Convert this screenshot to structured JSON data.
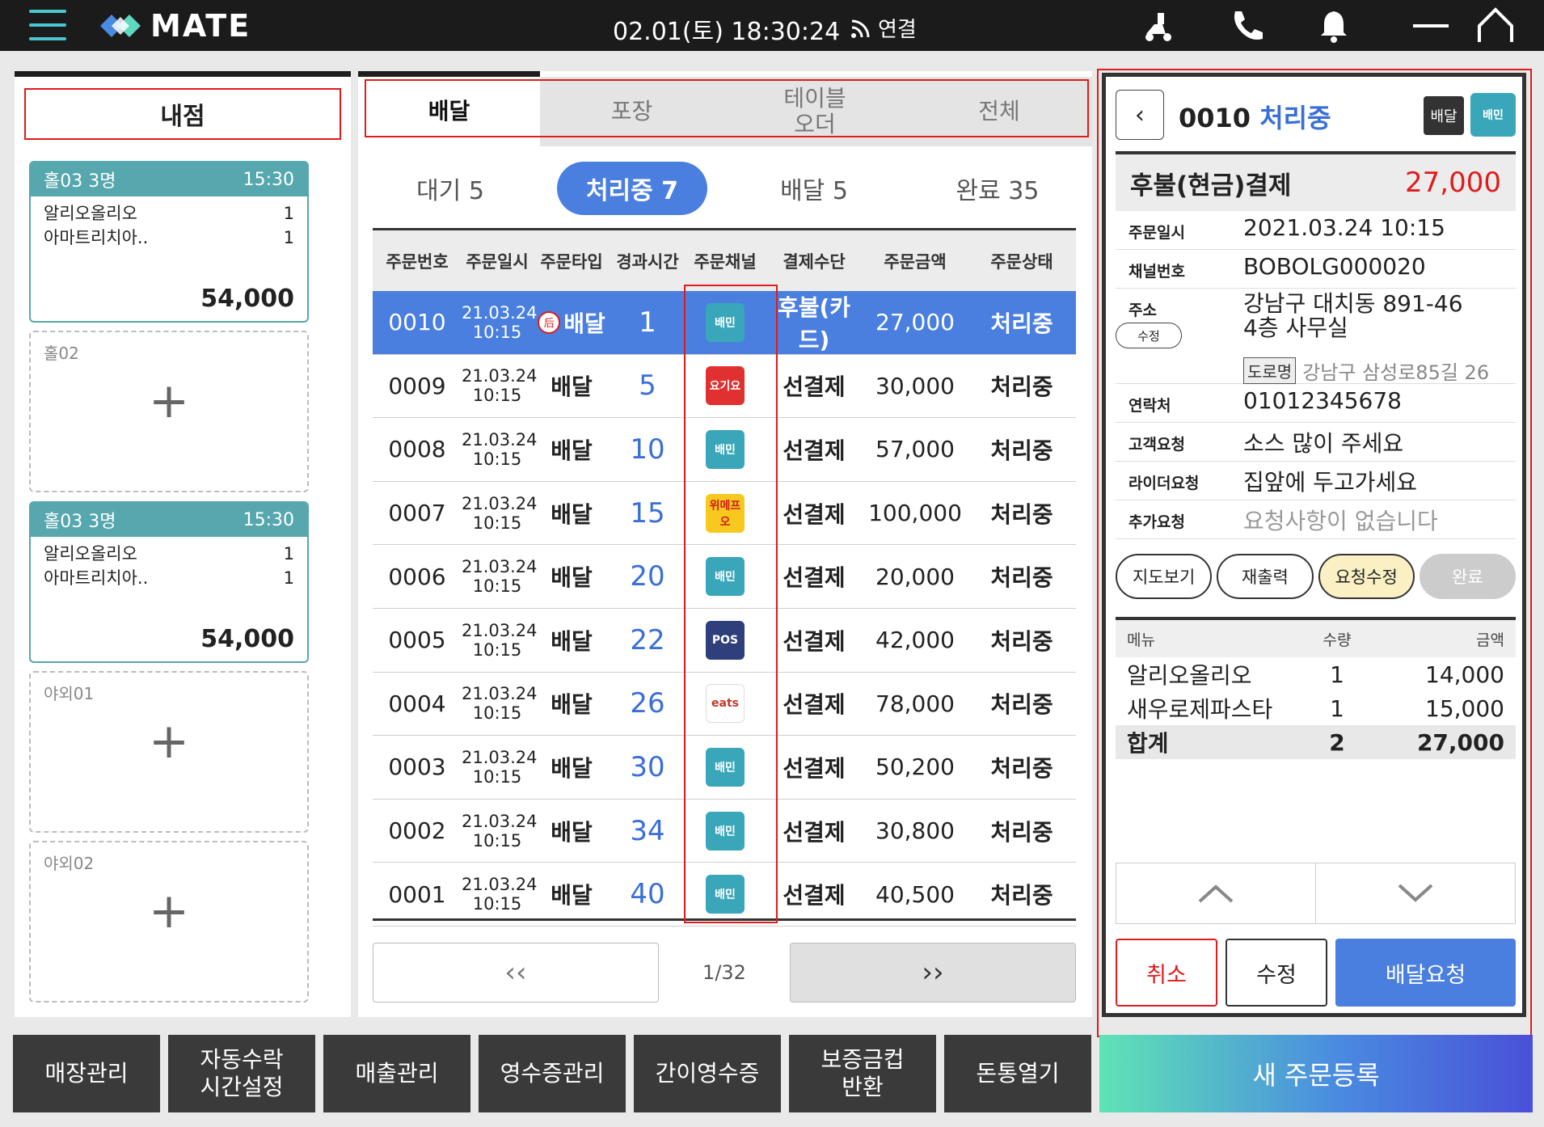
{
  "header": {
    "brand": "MATE",
    "datetime": "02.01(토) 18:30:24",
    "connection": "연결",
    "icons": [
      "menu-icon",
      "rider-icon",
      "phone-icon",
      "bell-icon",
      "minimize-icon",
      "home-icon"
    ]
  },
  "store": {
    "tab_label": "내점",
    "tables": [
      {
        "name": "홀03 3명",
        "time": "15:30",
        "items": [
          {
            "name": "알리오올리오",
            "qty": "1"
          },
          {
            "name": "아마트리치아..",
            "qty": "1"
          }
        ],
        "total": "54,000",
        "filled": true
      },
      {
        "name": "홀02",
        "filled": false,
        "add": "+"
      },
      {
        "name": "홀03 3명",
        "time": "15:30",
        "items": [
          {
            "name": "알리오올리오",
            "qty": "1"
          },
          {
            "name": "아마트리치아..",
            "qty": "1"
          }
        ],
        "total": "54,000",
        "filled": true
      },
      {
        "name": "야외01",
        "filled": false,
        "add": "+"
      },
      {
        "name": "야외02",
        "filled": false,
        "add": "+"
      }
    ]
  },
  "orders": {
    "tabs": [
      "배달",
      "포장",
      "테이블\n오더",
      "전체"
    ],
    "active_tab": 0,
    "statuses": [
      "대기 5",
      "처리중 7",
      "배달 5",
      "완료 35"
    ],
    "active_status": 1,
    "columns": [
      "주문번호",
      "주문일시",
      "주문타입",
      "경과시간",
      "주문채널",
      "결제수단",
      "주문금액",
      "주문상태"
    ],
    "rows": [
      {
        "no": "0010",
        "date": "21.03.24",
        "time": "10:15",
        "type": "배달",
        "type_badge": "后",
        "elapsed": "1",
        "channel": "baemin",
        "channel_label": "배민",
        "payment": "후불(카드)",
        "amount": "27,000",
        "status": "처리중",
        "selected": true
      },
      {
        "no": "0009",
        "date": "21.03.24",
        "time": "10:15",
        "type": "배달",
        "elapsed": "5",
        "channel": "yogiyo",
        "channel_label": "요기요",
        "payment": "선결제",
        "amount": "30,000",
        "status": "처리중"
      },
      {
        "no": "0008",
        "date": "21.03.24",
        "time": "10:15",
        "type": "배달",
        "elapsed": "10",
        "channel": "baemin",
        "channel_label": "배민",
        "payment": "선결제",
        "amount": "57,000",
        "status": "처리중"
      },
      {
        "no": "0007",
        "date": "21.03.24",
        "time": "10:15",
        "type": "배달",
        "elapsed": "15",
        "channel": "wemakeprice",
        "channel_label": "위메프오",
        "payment": "선결제",
        "amount": "100,000",
        "status": "처리중"
      },
      {
        "no": "0006",
        "date": "21.03.24",
        "time": "10:15",
        "type": "배달",
        "elapsed": "20",
        "channel": "baemin",
        "channel_label": "배민",
        "payment": "선결제",
        "amount": "20,000",
        "status": "처리중"
      },
      {
        "no": "0005",
        "date": "21.03.24",
        "time": "10:15",
        "type": "배달",
        "elapsed": "22",
        "channel": "pos",
        "channel_label": "POS",
        "payment": "선결제",
        "amount": "42,000",
        "status": "처리중"
      },
      {
        "no": "0004",
        "date": "21.03.24",
        "time": "10:15",
        "type": "배달",
        "elapsed": "26",
        "channel": "coupang",
        "channel_label": "eats",
        "payment": "선결제",
        "amount": "78,000",
        "status": "처리중"
      },
      {
        "no": "0003",
        "date": "21.03.24",
        "time": "10:15",
        "type": "배달",
        "elapsed": "30",
        "channel": "baemin",
        "channel_label": "배민",
        "payment": "선결제",
        "amount": "50,200",
        "status": "처리중"
      },
      {
        "no": "0002",
        "date": "21.03.24",
        "time": "10:15",
        "type": "배달",
        "elapsed": "34",
        "channel": "baemin",
        "channel_label": "배민",
        "payment": "선결제",
        "amount": "30,800",
        "status": "처리중"
      },
      {
        "no": "0001",
        "date": "21.03.24",
        "time": "10:15",
        "type": "배달",
        "elapsed": "40",
        "channel": "baemin",
        "channel_label": "배민",
        "payment": "선결제",
        "amount": "40,500",
        "status": "처리중"
      }
    ],
    "pager": {
      "prev": "‹‹",
      "next": "››",
      "page": "1/32"
    }
  },
  "detail": {
    "order_no": "0010",
    "status": "처리중",
    "type_badge": "배달",
    "channel_label": "배민",
    "payment_label": "후불(현금)결제",
    "payment_amount": "27,000",
    "fields": {
      "date_k": "주문일시",
      "date_v": "2021.03.24 10:15",
      "channel_k": "채널번호",
      "channel_v": "BOBOLG000020",
      "addr_k": "주소",
      "addr_edit": "수정",
      "addr_v1": "강남구 대치동 891-46",
      "addr_v2": "4층 사무실",
      "road_tag": "도로명",
      "road_v": "강남구 삼성로85길 26",
      "phone_k": "연락처",
      "phone_v": "01012345678",
      "cust_k": "고객요청",
      "cust_v": "소스 많이 주세요",
      "rider_k": "라이더요청",
      "rider_v": "집앞에 두고가세요",
      "extra_k": "추가요청",
      "extra_v": "요청사항이 없습니다"
    },
    "actions": [
      "지도보기",
      "재출력",
      "요청수정",
      "완료"
    ],
    "menu": {
      "headers": [
        "메뉴",
        "수량",
        "금액"
      ],
      "items": [
        {
          "name": "알리오올리오",
          "qty": "1",
          "amount": "14,000"
        },
        {
          "name": "새우로제파스타",
          "qty": "1",
          "amount": "15,000"
        }
      ],
      "total": {
        "label": "합계",
        "qty": "2",
        "amount": "27,000"
      }
    },
    "buttons": {
      "cancel": "취소",
      "edit": "수정",
      "deliver": "배달요청"
    }
  },
  "footer": {
    "buttons": [
      "매장관리",
      "자동수락\n시간설정",
      "매출관리",
      "영수증관리",
      "간이영수증",
      "보증금컵\n반환",
      "돈통열기"
    ],
    "new_order": "새 주문등록"
  },
  "colors": {
    "accent": "#4a7fe0",
    "teal": "#56a7ae",
    "red": "#e01b1b",
    "dark": "#1b1b1b"
  }
}
